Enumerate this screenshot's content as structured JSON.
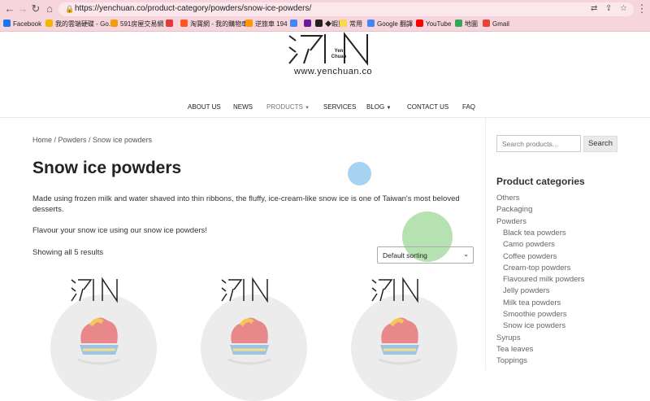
{
  "browser": {
    "url": "https://yenchuan.co/product-category/powders/snow-ice-powders/",
    "bookmarks": [
      {
        "label": "Facebook",
        "color": "#1877f2"
      },
      {
        "label": "我的雲端硬碟 - Go...",
        "color": "#f4b400"
      },
      {
        "label": "591房屋交易網",
        "color": "#f39c12"
      },
      {
        "label": "",
        "color": "#e53935"
      },
      {
        "label": "淘寶網 - 我的購物車",
        "color": "#ff5722"
      },
      {
        "label": "逆旅車 194",
        "color": "#ff9800"
      },
      {
        "label": "",
        "color": "#4285f4"
      },
      {
        "label": "",
        "color": "#6a1b9a"
      },
      {
        "label": "◆蝦買",
        "color": "#222222"
      },
      {
        "label": "常用",
        "color": "#f9d949"
      },
      {
        "label": "Google 翻譯",
        "color": "#4285f4"
      },
      {
        "label": "YouTube",
        "color": "#ff0000"
      },
      {
        "label": "地圖",
        "color": "#34a853"
      },
      {
        "label": "Gmail",
        "color": "#ea4335"
      }
    ]
  },
  "site": {
    "logo_text": "Yen Chuan",
    "logo_url": "www.yenchuan.co",
    "nav": [
      "ABOUT US",
      "NEWS",
      "PRODUCTS",
      "SERVICES",
      "BLOG",
      "CONTACT US",
      "FAQ"
    ]
  },
  "main": {
    "breadcrumb": "Home / Powders / Snow ice powders",
    "title": "Snow ice powders",
    "description": "Made using frozen milk and water shaved into thin ribbons, the fluffy, ice-cream-like snow ice is one of Taiwan's most beloved desserts.",
    "description2": "Flavour your snow ice using our snow ice powders!",
    "result_count": "Showing all 5 results",
    "sort_label": "Default sorting"
  },
  "sidebar": {
    "search_placeholder": "Search products...",
    "search_button": "Search",
    "categories_heading": "Product categories",
    "categories": [
      {
        "label": "Others",
        "indent": false
      },
      {
        "label": "Packaging",
        "indent": false
      },
      {
        "label": "Powders",
        "indent": false
      },
      {
        "label": "Black tea powders",
        "indent": true
      },
      {
        "label": "Camo powders",
        "indent": true
      },
      {
        "label": "Coffee powders",
        "indent": true
      },
      {
        "label": "Cream-top powders",
        "indent": true
      },
      {
        "label": "Flavoured milk powders",
        "indent": true
      },
      {
        "label": "Jelly powders",
        "indent": true
      },
      {
        "label": "Milk tea powders",
        "indent": true
      },
      {
        "label": "Smoothie powders",
        "indent": true
      },
      {
        "label": "Snow ice powders",
        "indent": true
      },
      {
        "label": "Syrups",
        "indent": false
      },
      {
        "label": "Tea leaves",
        "indent": false
      },
      {
        "label": "Toppings",
        "indent": false
      }
    ]
  }
}
